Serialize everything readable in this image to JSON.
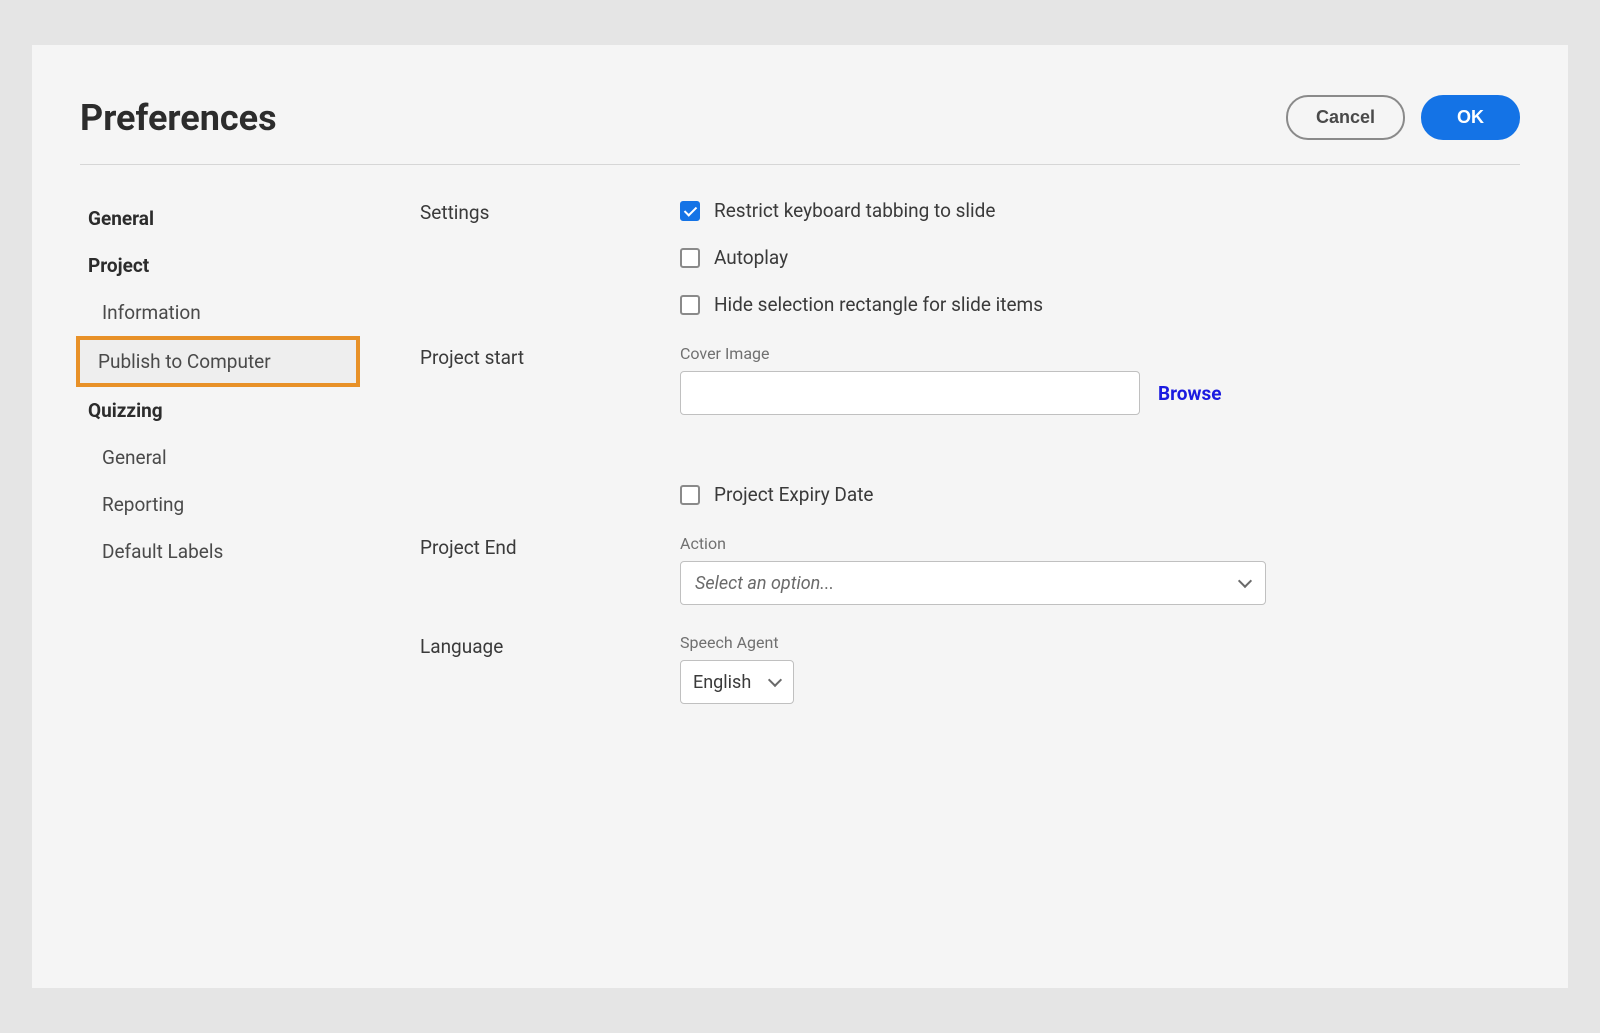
{
  "title": "Preferences",
  "buttons": {
    "cancel": "Cancel",
    "ok": "OK"
  },
  "sidebar": {
    "general": "General",
    "project": "Project",
    "project_information": "Information",
    "project_publish": "Publish to Computer",
    "quizzing": "Quizzing",
    "quizzing_general": "General",
    "quizzing_reporting": "Reporting",
    "quizzing_default_labels": "Default Labels"
  },
  "sections": {
    "settings": {
      "label": "Settings",
      "restrict_tabbing": "Restrict keyboard tabbing to slide",
      "autoplay": "Autoplay",
      "hide_selection": "Hide selection rectangle for slide items"
    },
    "project_start": {
      "label": "Project start",
      "cover_image_label": "Cover Image",
      "cover_image_value": "",
      "browse": "Browse",
      "expiry_date": "Project Expiry Date"
    },
    "project_end": {
      "label": "Project End",
      "action_label": "Action",
      "action_placeholder": "Select an option..."
    },
    "language": {
      "label": "Language",
      "speech_agent_label": "Speech Agent",
      "speech_agent_value": "English"
    }
  }
}
